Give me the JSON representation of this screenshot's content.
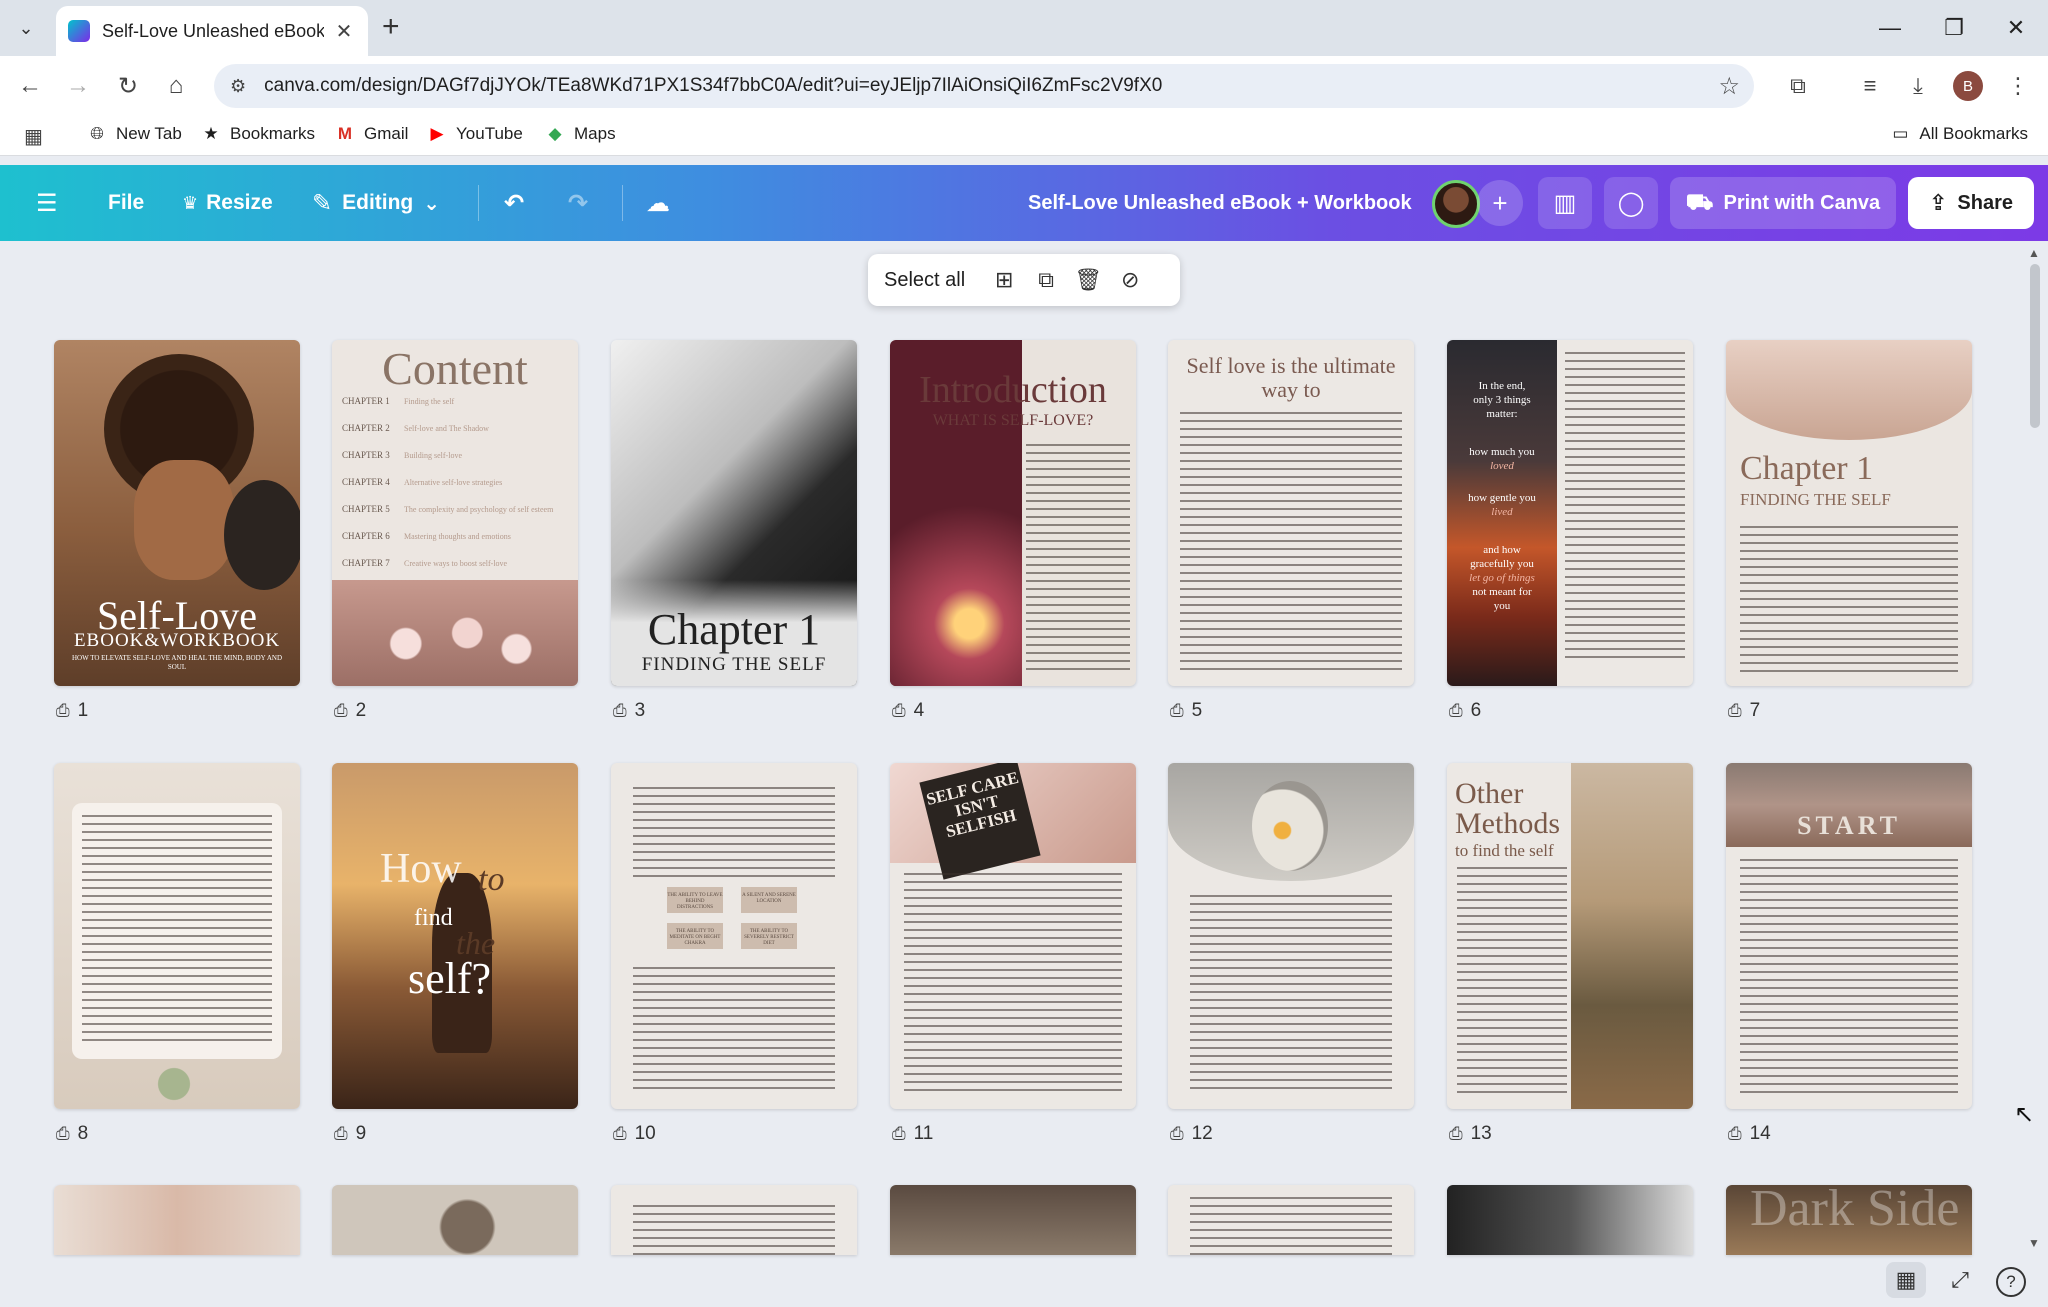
{
  "browser": {
    "tab_title": "Self-Love Unleashed eBook + W",
    "url": "canva.com/design/DAGf7djJYOk/TEa8WKd71PX1S34f7bbC0A/edit?ui=eyJEljp7IlAiOnsiQiI6ZmFsc2V9fX0",
    "profile_initial": "B",
    "bookmarks": [
      {
        "label": "New Tab",
        "icon": "globe-icon"
      },
      {
        "label": "Bookmarks",
        "icon": "star-icon"
      },
      {
        "label": "Gmail",
        "icon": "gmail-icon"
      },
      {
        "label": "YouTube",
        "icon": "youtube-icon"
      },
      {
        "label": "Maps",
        "icon": "maps-icon"
      }
    ],
    "all_bookmarks": "All Bookmarks"
  },
  "toolbar": {
    "file": "File",
    "resize": "Resize",
    "editing": "Editing",
    "doc_title": "Self-Love Unleashed eBook + Workbook",
    "print": "Print with Canva",
    "share": "Share"
  },
  "selection_bar": {
    "select_all": "Select all"
  },
  "pages": [
    {
      "num": "1",
      "title": "Self-Love",
      "subtitle": "EBOOK&WORKBOOK",
      "tagline": "HOW TO ELEVATE SELF-LOVE AND HEAL THE MIND, BODY AND SOUL",
      "bg": "#a87a55"
    },
    {
      "num": "2",
      "title": "Content",
      "chapters": [
        {
          "ch": "CHAPTER 1",
          "name": "Finding the self"
        },
        {
          "ch": "CHAPTER 2",
          "name": "Self-love and The Shadow"
        },
        {
          "ch": "CHAPTER 3",
          "name": "Building self-love"
        },
        {
          "ch": "CHAPTER 4",
          "name": "Alternative self-love strategies"
        },
        {
          "ch": "CHAPTER 5",
          "name": "The complexity and psychology of self esteem"
        },
        {
          "ch": "CHAPTER 6",
          "name": "Mastering thoughts and emotions"
        },
        {
          "ch": "CHAPTER 7",
          "name": "Creative ways to boost self-love"
        }
      ],
      "bg": "#ece6e1"
    },
    {
      "num": "3",
      "title": "Chapter 1",
      "subtitle": "FINDING THE SELF",
      "bg": "#d7d7d7"
    },
    {
      "num": "4",
      "title": "Introduction",
      "subtitle": "WHAT IS SELF-LOVE?",
      "bg": "#e9e3dd"
    },
    {
      "num": "5",
      "title": "Self love is the ultimate way to",
      "bg": "#ece8e4"
    },
    {
      "num": "6",
      "quote_lines": [
        "In the end,",
        "only 3 things",
        "matter:",
        "how much you",
        "loved",
        "how gentle you",
        "lived",
        "and how",
        "gracefully you",
        "let go of things",
        "not meant for",
        "you"
      ],
      "bg": "#ece8e4"
    },
    {
      "num": "7",
      "title": "Chapter 1",
      "subtitle": "FINDING THE SELF",
      "bg": "#ebe6e1"
    },
    {
      "num": "8",
      "bg": "#ebe4dc"
    },
    {
      "num": "9",
      "title_a": "How",
      "title_b": "to",
      "title_c": "find",
      "title_d": "the",
      "title_e": "self?",
      "bg": "#6b4a36"
    },
    {
      "num": "10",
      "box_labels": [
        "THE ABILITY TO LEAVE BEHIND DISTRACTIONS",
        "A SILENT AND SERENE LOCATION",
        "THE ABILITY TO MEDITATE ON BEGHT CHAKRA",
        "THE ABILITY TO SEVERELY RESTRICT DIET"
      ],
      "bg": "#ece8e4"
    },
    {
      "num": "11",
      "sign_text": "SELF CARE ISN'T SELFISH",
      "bg": "#ece8e4"
    },
    {
      "num": "12",
      "bg": "#ece8e4"
    },
    {
      "num": "13",
      "title": "Other Methods",
      "subtitle": "to find the self",
      "bg": "#ece8e4"
    },
    {
      "num": "14",
      "sign_text": "START",
      "bg": "#ece8e4"
    },
    {
      "num": "",
      "bg": "#d9c3b3"
    },
    {
      "num": "",
      "bg": "#cfc6bb"
    },
    {
      "num": "",
      "bg": "#ece8e4"
    },
    {
      "num": "",
      "bg": "#7a6a5c"
    },
    {
      "num": "",
      "bg": "#ece8e4"
    },
    {
      "num": "",
      "bg": "#555555"
    },
    {
      "num": "",
      "title": "Dark Side",
      "bg": "#8a6a4a"
    }
  ]
}
